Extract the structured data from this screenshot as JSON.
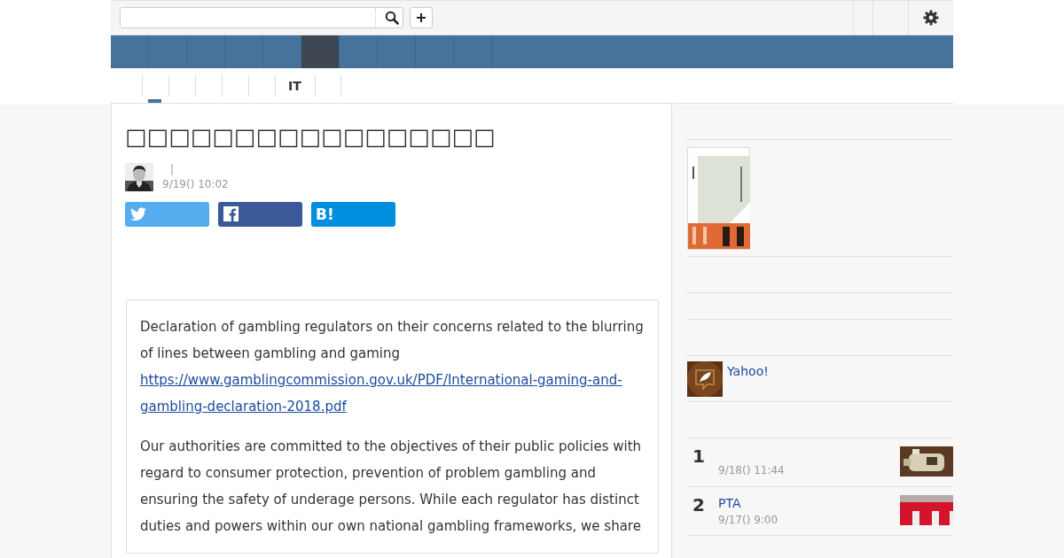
{
  "nav_tabs": [
    {
      "selected": false
    },
    {
      "selected": false
    },
    {
      "selected": false
    },
    {
      "selected": false
    },
    {
      "selected": false
    },
    {
      "selected": true
    },
    {
      "selected": false
    },
    {
      "selected": false
    },
    {
      "selected": false
    },
    {
      "selected": false
    }
  ],
  "sub_tabs": [
    {
      "selected": true
    },
    {
      "selected": false
    },
    {
      "selected": false
    },
    {
      "selected": false
    },
    {
      "selected": false
    },
    {
      "label": "IT",
      "selected": false
    },
    {
      "selected": false
    }
  ],
  "article": {
    "title": "□□□□□□□□□□□□□□□□□",
    "byline_separator": "|",
    "date": "9/19() 10:02",
    "share_buttons": [
      {
        "kind": "twitter"
      },
      {
        "kind": "facebook"
      },
      {
        "kind": "hatena",
        "label": "B!"
      }
    ],
    "quote": [
      {
        "text": "Declaration of gambling regulators on their concerns related to the blurring of lines between gambling and gaming",
        "link": "https://www.gamblingcommission.gov.uk/PDF/International-gaming-and-gambling-declaration-2018.pdf"
      },
      {
        "text": "Our authorities are committed to the objectives of their public policies with regard to consumer protection, prevention of problem gambling and ensuring the safety of underage persons. While each regulator has distinct duties and powers within our own national gambling frameworks, we share"
      }
    ]
  },
  "sidebar": {
    "yahoo_link": "Yahoo!",
    "ranking": [
      {
        "rank": "1",
        "date": "9/18() 11:44"
      },
      {
        "rank": "2",
        "title": "PTA",
        "date": "9/17() 9:00"
      }
    ]
  }
}
